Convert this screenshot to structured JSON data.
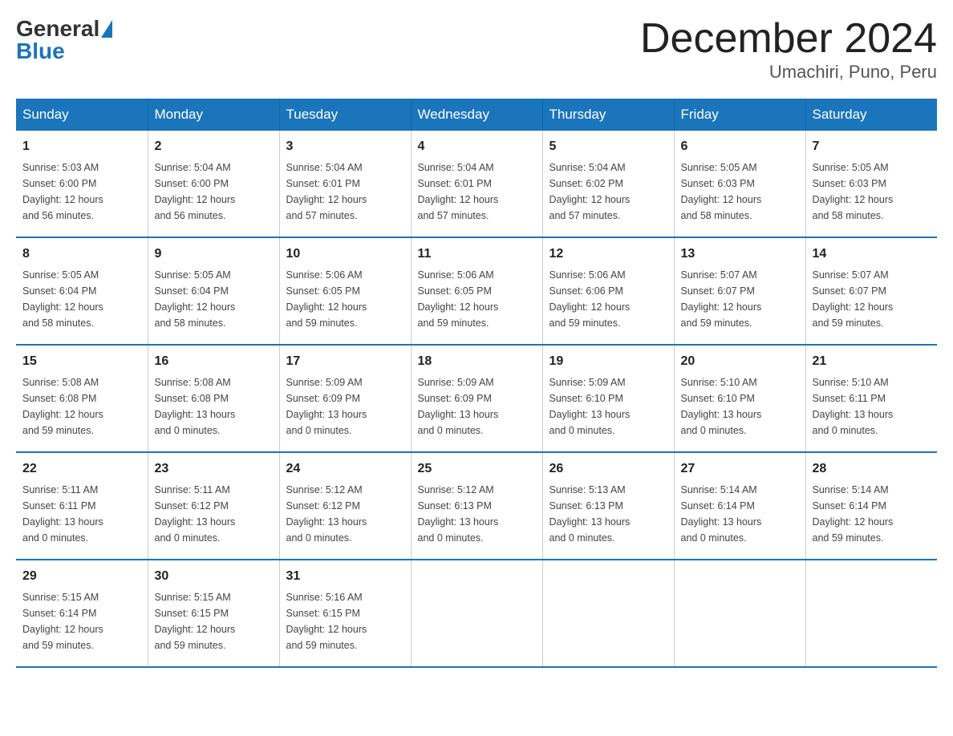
{
  "header": {
    "logo_general": "General",
    "logo_blue": "Blue",
    "month_title": "December 2024",
    "location": "Umachiri, Puno, Peru"
  },
  "days_of_week": [
    "Sunday",
    "Monday",
    "Tuesday",
    "Wednesday",
    "Thursday",
    "Friday",
    "Saturday"
  ],
  "weeks": [
    [
      {
        "day": "1",
        "sunrise": "5:03 AM",
        "sunset": "6:00 PM",
        "daylight": "12 hours and 56 minutes."
      },
      {
        "day": "2",
        "sunrise": "5:04 AM",
        "sunset": "6:00 PM",
        "daylight": "12 hours and 56 minutes."
      },
      {
        "day": "3",
        "sunrise": "5:04 AM",
        "sunset": "6:01 PM",
        "daylight": "12 hours and 57 minutes."
      },
      {
        "day": "4",
        "sunrise": "5:04 AM",
        "sunset": "6:01 PM",
        "daylight": "12 hours and 57 minutes."
      },
      {
        "day": "5",
        "sunrise": "5:04 AM",
        "sunset": "6:02 PM",
        "daylight": "12 hours and 57 minutes."
      },
      {
        "day": "6",
        "sunrise": "5:05 AM",
        "sunset": "6:03 PM",
        "daylight": "12 hours and 58 minutes."
      },
      {
        "day": "7",
        "sunrise": "5:05 AM",
        "sunset": "6:03 PM",
        "daylight": "12 hours and 58 minutes."
      }
    ],
    [
      {
        "day": "8",
        "sunrise": "5:05 AM",
        "sunset": "6:04 PM",
        "daylight": "12 hours and 58 minutes."
      },
      {
        "day": "9",
        "sunrise": "5:05 AM",
        "sunset": "6:04 PM",
        "daylight": "12 hours and 58 minutes."
      },
      {
        "day": "10",
        "sunrise": "5:06 AM",
        "sunset": "6:05 PM",
        "daylight": "12 hours and 59 minutes."
      },
      {
        "day": "11",
        "sunrise": "5:06 AM",
        "sunset": "6:05 PM",
        "daylight": "12 hours and 59 minutes."
      },
      {
        "day": "12",
        "sunrise": "5:06 AM",
        "sunset": "6:06 PM",
        "daylight": "12 hours and 59 minutes."
      },
      {
        "day": "13",
        "sunrise": "5:07 AM",
        "sunset": "6:07 PM",
        "daylight": "12 hours and 59 minutes."
      },
      {
        "day": "14",
        "sunrise": "5:07 AM",
        "sunset": "6:07 PM",
        "daylight": "12 hours and 59 minutes."
      }
    ],
    [
      {
        "day": "15",
        "sunrise": "5:08 AM",
        "sunset": "6:08 PM",
        "daylight": "12 hours and 59 minutes."
      },
      {
        "day": "16",
        "sunrise": "5:08 AM",
        "sunset": "6:08 PM",
        "daylight": "13 hours and 0 minutes."
      },
      {
        "day": "17",
        "sunrise": "5:09 AM",
        "sunset": "6:09 PM",
        "daylight": "13 hours and 0 minutes."
      },
      {
        "day": "18",
        "sunrise": "5:09 AM",
        "sunset": "6:09 PM",
        "daylight": "13 hours and 0 minutes."
      },
      {
        "day": "19",
        "sunrise": "5:09 AM",
        "sunset": "6:10 PM",
        "daylight": "13 hours and 0 minutes."
      },
      {
        "day": "20",
        "sunrise": "5:10 AM",
        "sunset": "6:10 PM",
        "daylight": "13 hours and 0 minutes."
      },
      {
        "day": "21",
        "sunrise": "5:10 AM",
        "sunset": "6:11 PM",
        "daylight": "13 hours and 0 minutes."
      }
    ],
    [
      {
        "day": "22",
        "sunrise": "5:11 AM",
        "sunset": "6:11 PM",
        "daylight": "13 hours and 0 minutes."
      },
      {
        "day": "23",
        "sunrise": "5:11 AM",
        "sunset": "6:12 PM",
        "daylight": "13 hours and 0 minutes."
      },
      {
        "day": "24",
        "sunrise": "5:12 AM",
        "sunset": "6:12 PM",
        "daylight": "13 hours and 0 minutes."
      },
      {
        "day": "25",
        "sunrise": "5:12 AM",
        "sunset": "6:13 PM",
        "daylight": "13 hours and 0 minutes."
      },
      {
        "day": "26",
        "sunrise": "5:13 AM",
        "sunset": "6:13 PM",
        "daylight": "13 hours and 0 minutes."
      },
      {
        "day": "27",
        "sunrise": "5:14 AM",
        "sunset": "6:14 PM",
        "daylight": "13 hours and 0 minutes."
      },
      {
        "day": "28",
        "sunrise": "5:14 AM",
        "sunset": "6:14 PM",
        "daylight": "12 hours and 59 minutes."
      }
    ],
    [
      {
        "day": "29",
        "sunrise": "5:15 AM",
        "sunset": "6:14 PM",
        "daylight": "12 hours and 59 minutes."
      },
      {
        "day": "30",
        "sunrise": "5:15 AM",
        "sunset": "6:15 PM",
        "daylight": "12 hours and 59 minutes."
      },
      {
        "day": "31",
        "sunrise": "5:16 AM",
        "sunset": "6:15 PM",
        "daylight": "12 hours and 59 minutes."
      },
      null,
      null,
      null,
      null
    ]
  ],
  "labels": {
    "sunrise": "Sunrise:",
    "sunset": "Sunset:",
    "daylight": "Daylight:"
  }
}
